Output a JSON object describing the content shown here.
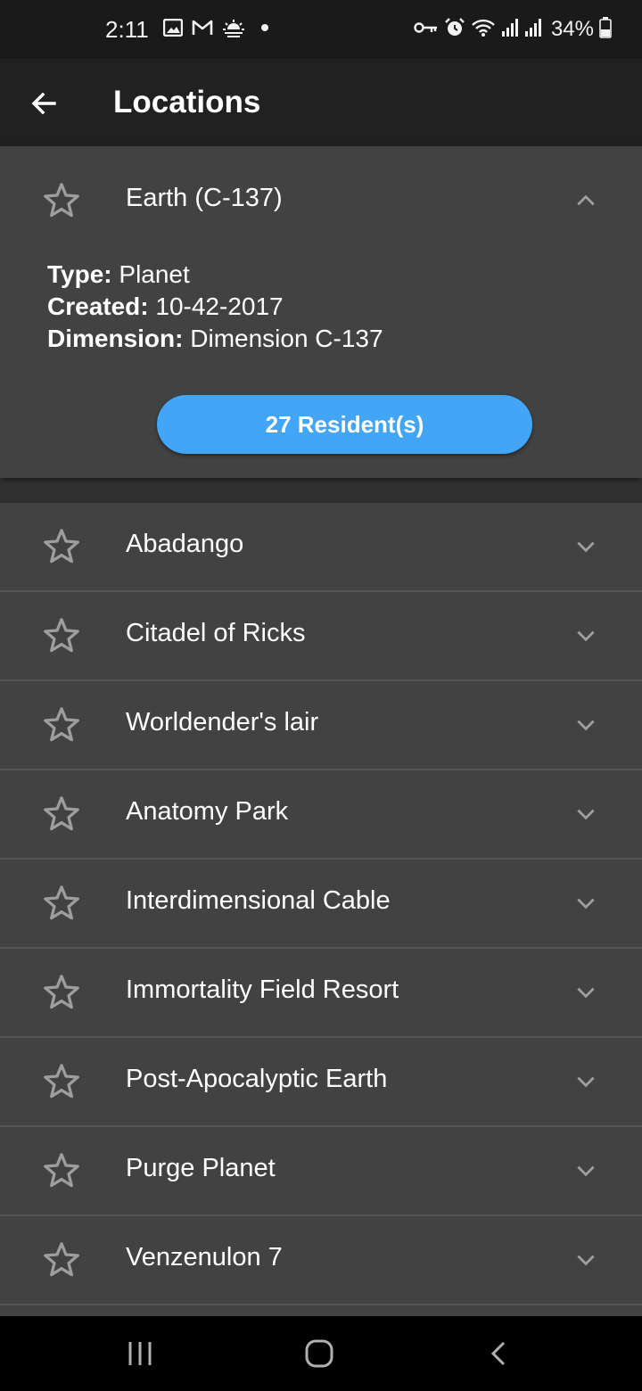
{
  "status_bar": {
    "time": "2:11",
    "battery": "34%",
    "left_icons": [
      "image-icon",
      "gmail-icon",
      "weather-sunrise-icon",
      "notification-dot-icon"
    ],
    "right_icons": [
      "vpn-key-icon",
      "alarm-icon",
      "wifi-icon",
      "signal-icon",
      "signal-icon",
      "battery-icon"
    ]
  },
  "app_bar": {
    "title": "Locations",
    "back_icon": "arrow-back-icon"
  },
  "expanded": {
    "name": "Earth (C-137)",
    "type_label": "Type:",
    "type_value": "Planet",
    "created_label": "Created:",
    "created_value": "10-42-2017",
    "dimension_label": "Dimension:",
    "dimension_value": "Dimension C-137",
    "residents_button": "27 Resident(s)",
    "favorited": false
  },
  "locations": [
    {
      "name": "Abadango"
    },
    {
      "name": "Citadel of Ricks"
    },
    {
      "name": "Worldender's lair"
    },
    {
      "name": "Anatomy Park"
    },
    {
      "name": "Interdimensional Cable"
    },
    {
      "name": "Immortality Field Resort"
    },
    {
      "name": "Post-Apocalyptic Earth"
    },
    {
      "name": "Purge Planet"
    },
    {
      "name": "Venzenulon 7"
    }
  ],
  "colors": {
    "status_bar_bg": "#1a1a1a",
    "app_bar_bg": "#212121",
    "page_bg": "#303030",
    "card_bg": "#424242",
    "divider": "#555555",
    "accent": "#42a5f5",
    "icon_gray": "#9e9e9e"
  },
  "nav_bar": {
    "icons": [
      "recent-apps-icon",
      "home-icon",
      "back-nav-icon"
    ]
  }
}
